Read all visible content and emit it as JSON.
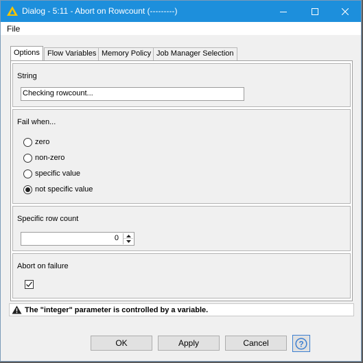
{
  "window": {
    "title": "Dialog - 5:11 - Abort on Rowcount (---------)",
    "app_icon": "knime-triangle-icon",
    "controls": [
      "minimize-icon",
      "maximize-icon",
      "close-icon"
    ]
  },
  "menubar": {
    "file": "File"
  },
  "tabs": [
    {
      "label": "Options",
      "active": true
    },
    {
      "label": "Flow Variables",
      "active": false
    },
    {
      "label": "Memory Policy",
      "active": false
    },
    {
      "label": "Job Manager Selection",
      "active": false
    }
  ],
  "string_panel": {
    "title": "String",
    "value": "Checking rowcount..."
  },
  "fail_panel": {
    "title": "Fail when...",
    "options": [
      {
        "label": "zero",
        "checked": false
      },
      {
        "label": "non-zero",
        "checked": false
      },
      {
        "label": "specific value",
        "checked": false
      },
      {
        "label": "not specific value",
        "checked": true
      }
    ]
  },
  "rowcount_panel": {
    "title": "Specific row count",
    "value": "0"
  },
  "abort_panel": {
    "title": "Abort on failure",
    "checked": true
  },
  "status": {
    "icon": "warning-icon",
    "text": "The \"integer\" parameter is controlled by a variable."
  },
  "buttons": {
    "ok": "OK",
    "apply": "Apply",
    "cancel": "Cancel",
    "help_icon": "help-icon"
  },
  "colors": {
    "titlebar": "#1d8fdc",
    "help_border": "#3c7fd1"
  }
}
